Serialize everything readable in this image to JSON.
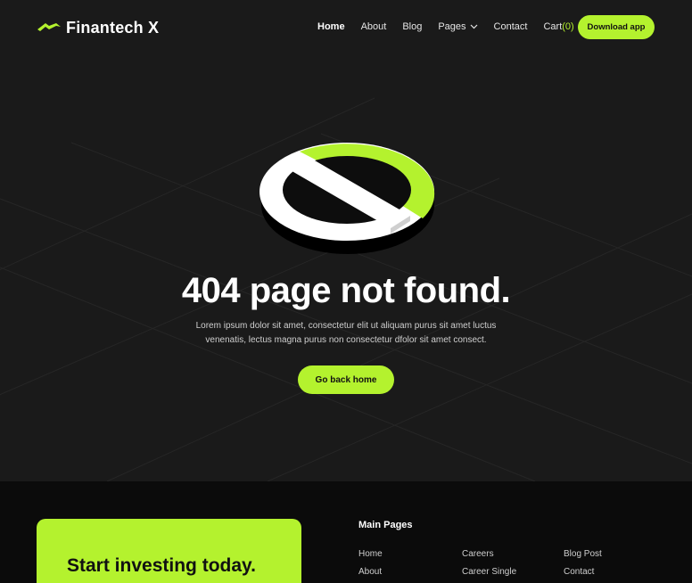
{
  "brand": {
    "name": "Finantech X",
    "accent_color": "#b4f22e",
    "logo_icon": "chevron-wing-icon"
  },
  "nav": {
    "items": [
      {
        "label": "Home",
        "active": true
      },
      {
        "label": "About",
        "active": false
      },
      {
        "label": "Blog",
        "active": false
      },
      {
        "label": "Pages",
        "active": false,
        "has_dropdown": true
      },
      {
        "label": "Contact",
        "active": false
      }
    ],
    "cart_label": "Cart",
    "cart_count": "(0)",
    "download_label": "Download app"
  },
  "error": {
    "illustration_icon": "prohibited-sign-icon",
    "title": "404 page not found.",
    "description_line1": "Lorem ipsum dolor sit amet, consectetur elit ut aliquam purus sit amet luctus",
    "description_line2": "venenatis, lectus magna purus non consectetur dfolor sit amet consect.",
    "button_label": "Go back home"
  },
  "footer": {
    "cta_title": "Start investing today.",
    "main_pages_heading": "Main Pages",
    "columns": [
      [
        "Home",
        "About"
      ],
      [
        "Careers",
        "Career Single"
      ],
      [
        "Blog Post",
        "Contact"
      ]
    ]
  }
}
